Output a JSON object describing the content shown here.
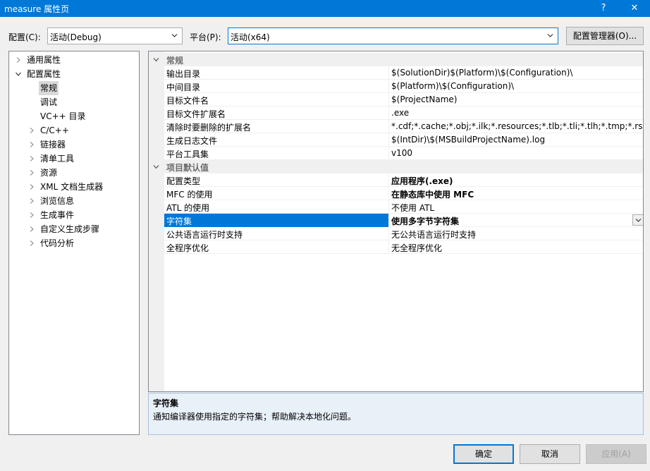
{
  "window": {
    "title": "measure 属性页",
    "help_label": "?",
    "close_label": "✕"
  },
  "toolbar": {
    "config_label": "配置(C):",
    "config_value": "活动(Debug)",
    "platform_label": "平台(P):",
    "platform_value": "活动(x64)",
    "config_manager_label": "配置管理器(O)..."
  },
  "tree": {
    "items": [
      {
        "label": "通用属性"
      },
      {
        "label": "配置属性"
      },
      {
        "label": "常规"
      },
      {
        "label": "调试"
      },
      {
        "label": "VC++ 目录"
      },
      {
        "label": "C/C++"
      },
      {
        "label": "链接器"
      },
      {
        "label": "清单工具"
      },
      {
        "label": "资源"
      },
      {
        "label": "XML 文档生成器"
      },
      {
        "label": "浏览信息"
      },
      {
        "label": "生成事件"
      },
      {
        "label": "自定义生成步骤"
      },
      {
        "label": "代码分析"
      }
    ]
  },
  "grid": {
    "categories": [
      {
        "label": "常规"
      },
      {
        "label": "项目默认值"
      }
    ],
    "general_rows": [
      {
        "name": "输出目录",
        "value": "$(SolutionDir)$(Platform)\\$(Configuration)\\"
      },
      {
        "name": "中间目录",
        "value": "$(Platform)\\$(Configuration)\\"
      },
      {
        "name": "目标文件名",
        "value": "$(ProjectName)"
      },
      {
        "name": "目标文件扩展名",
        "value": ".exe"
      },
      {
        "name": "清除时要删除的扩展名",
        "value": "*.cdf;*.cache;*.obj;*.ilk;*.resources;*.tlb;*.tli;*.tlh;*.tmp;*.rsp;*.pgc"
      },
      {
        "name": "生成日志文件",
        "value": "$(IntDir)\\$(MSBuildProjectName).log"
      },
      {
        "name": "平台工具集",
        "value": "v100"
      }
    ],
    "default_rows": [
      {
        "name": "配置类型",
        "value": "应用程序(.exe)"
      },
      {
        "name": "MFC 的使用",
        "value": "在静态库中使用 MFC"
      },
      {
        "name": "ATL 的使用",
        "value": "不使用 ATL"
      },
      {
        "name": "字符集",
        "value": "使用多字节字符集"
      },
      {
        "name": "公共语言运行时支持",
        "value": "无公共语言运行时支持"
      },
      {
        "name": "全程序优化",
        "value": "无全程序优化"
      }
    ]
  },
  "description": {
    "title": "字符集",
    "text": "通知编译器使用指定的字符集；帮助解决本地化问题。"
  },
  "buttons": {
    "ok": "确定",
    "cancel": "取消",
    "apply": "应用(A)"
  },
  "colors": {
    "accent": "#0078d7",
    "category_text": "#6d6d6d"
  }
}
